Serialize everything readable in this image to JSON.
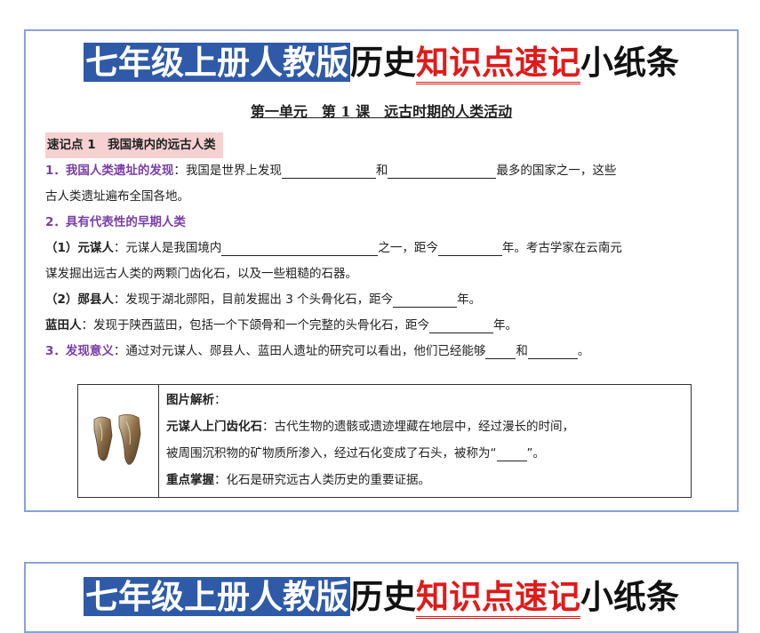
{
  "title": {
    "part1": "七年级上册人教版",
    "part2": "历史",
    "part3": "知识点速记",
    "part4": "小纸条"
  },
  "subtitle": "第一单元　第 1 课　远古时期的人类活动",
  "section1": {
    "heading": "速记点 1　我国境内的远古人类"
  },
  "p1": {
    "label": "1．我国人类遗址的发现",
    "colon": "：",
    "text_a": "我国是世界上发现",
    "text_b": "和",
    "text_c": "最多的国家之一，这些",
    "text_d": "古人类遗址遍布全国各地。"
  },
  "p2": {
    "label": "2．具有代表性的早期人类"
  },
  "yuanmou": {
    "label": "（1）元谋人",
    "text_a": "：元谋人是我国境内",
    "text_b": "之一，距今",
    "text_c": "年。考古学家在云南元",
    "text_d": "谋发掘出远古人类的两颗门齿化石，以及一些粗糙的石器。"
  },
  "yunxian": {
    "label": "（2）郧县人",
    "text_a": "：发现于湖北郧阳，目前发掘出 3 个头骨化石，距今",
    "text_b": "年。"
  },
  "lantian": {
    "label": "蓝田人",
    "text_a": "：发现于陕西蓝田，包括一个下颌骨和一个完整的头骨化石，距今",
    "text_b": "年。"
  },
  "p3": {
    "label": "3．发现意义",
    "text_a": "：通过对元谋人、郧县人、蓝田人遗址的研究可以看出，他们已经能够",
    "text_b": "和",
    "text_c": "。"
  },
  "box": {
    "heading": "图片解析",
    "heading_colon": "：",
    "item1_label": "元谋人上门齿化石",
    "item1_text_a": "：古代生物的遗骸或遗迹埋藏在地层中，经过漫长的时间，",
    "item1_text_b": "被周围沉积物的矿物质所渗入，经过石化变成了石头，被称为“",
    "item1_text_c": "”。",
    "item2_label": "重点掌握",
    "item2_text": "：化石是研究远古人类历史的重要证据。"
  }
}
